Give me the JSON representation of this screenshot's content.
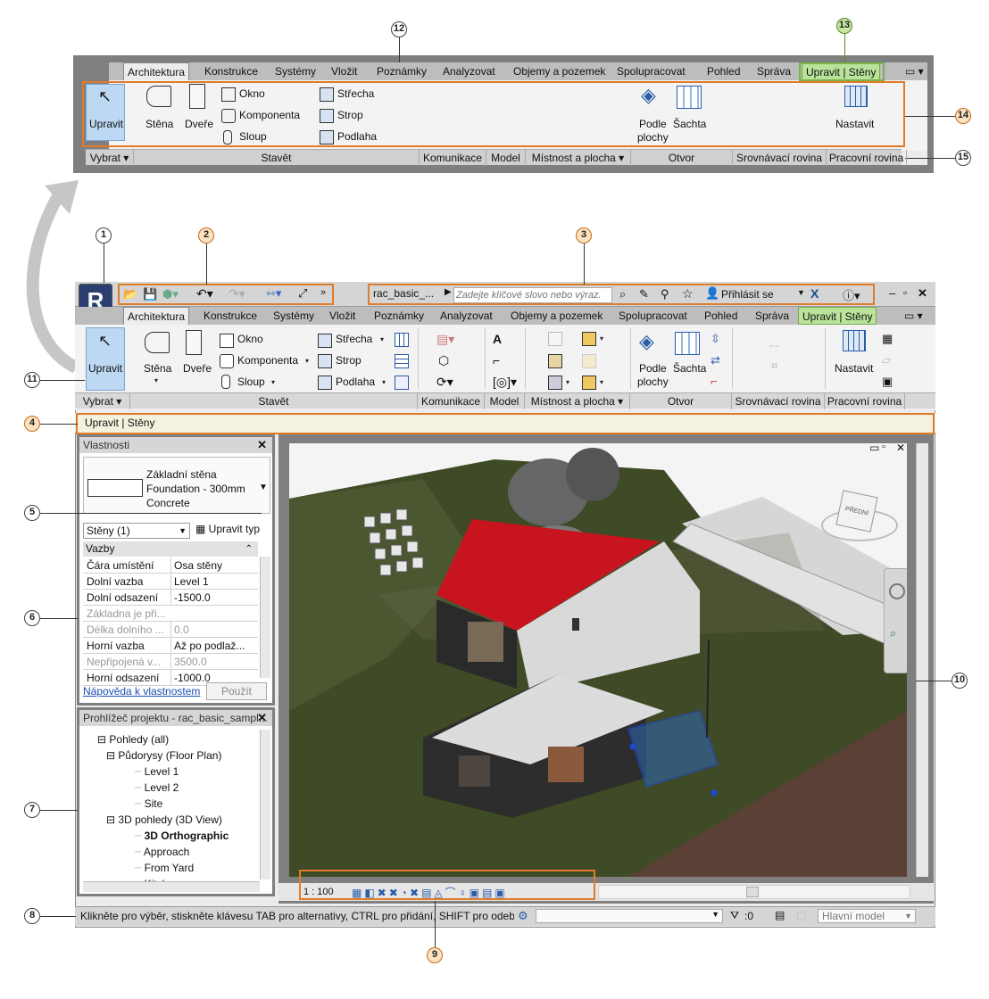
{
  "ribbon": {
    "tabs": [
      "Architektura",
      "Konstrukce",
      "Systémy",
      "Vložit",
      "Poznámky",
      "Analyzovat",
      "Objemy a pozemek",
      "Spolupracovat",
      "Pohled",
      "Správa"
    ],
    "context_tab": "Upravit | Stěny",
    "select_button": "Upravit",
    "wall": "Stěna",
    "door": "Dveře",
    "window": "Okno",
    "component": "Komponenta",
    "column": "Sloup",
    "roof": "Střecha",
    "ceiling": "Strop",
    "floor": "Podlaha",
    "opening_by_face": [
      "Podle",
      "plochy"
    ],
    "shaft": "Šachta",
    "set_workplane": "Nastavit",
    "panels": [
      "Vybrat",
      "Stavět",
      "Komunikace",
      "Model",
      "Místnost a plocha",
      "Otvor",
      "Srovnávací rovina",
      "Pracovní rovina"
    ]
  },
  "qat": {
    "file_name": "rac_basic_...",
    "search_placeholder": "Zadejte klíčové slovo nebo výraz.",
    "sign_in": "Přihlásit se"
  },
  "options_bar": "Upravit | Stěny",
  "properties": {
    "title": "Vlastnosti",
    "type_lines": [
      "Základní stěna",
      "Foundation - 300mm",
      "Concrete"
    ],
    "instance_filter": "Stěny (1)",
    "edit_type": "Upravit typ",
    "group": "Vazby",
    "rows": [
      {
        "k": "Čára umístění",
        "v": "Osa stěny",
        "dim": false
      },
      {
        "k": "Dolní vazba",
        "v": "Level 1",
        "dim": false
      },
      {
        "k": "Dolní odsazení",
        "v": "-1500.0",
        "dim": false
      },
      {
        "k": "Základna je při...",
        "v": "",
        "dim": true
      },
      {
        "k": "Délka dolního ...",
        "v": "0.0",
        "dim": true
      },
      {
        "k": "Horní vazba",
        "v": "Až po podlaž...",
        "dim": false
      },
      {
        "k": "Nepřipojená v...",
        "v": "3500.0",
        "dim": true
      },
      {
        "k": "Horní odsazení",
        "v": "-1000.0",
        "dim": false
      }
    ],
    "help_link": "Nápověda k vlastnostem",
    "apply": "Použít"
  },
  "browser": {
    "title": "Prohlížeč projektu - rac_basic_sampl...",
    "items": [
      {
        "label": "Pohledy (all)",
        "bold": false
      },
      {
        "label": "Půdorysy (Floor Plan)",
        "bold": false
      },
      {
        "label": "Level 1",
        "bold": false
      },
      {
        "label": "Level 2",
        "bold": false
      },
      {
        "label": "Site",
        "bold": false
      },
      {
        "label": "3D pohledy (3D View)",
        "bold": false
      },
      {
        "label": "3D Orthographic",
        "bold": true
      },
      {
        "label": "Approach",
        "bold": false
      },
      {
        "label": "From Yard",
        "bold": false
      },
      {
        "label": "Kitchen",
        "bold": false
      }
    ]
  },
  "view_control_bar": {
    "scale": "1 : 100"
  },
  "status": {
    "message": "Klikněte pro výběr, stiskněte klávesu TAB pro alternativy, CTRL pro přidání, SHIFT pro odebrá",
    "zero": ":0",
    "model": "Hlavní model"
  },
  "viewcube": {
    "front": "PŘEDNÍ",
    "right": "VPRAVO"
  },
  "callouts": [
    "1",
    "2",
    "3",
    "4",
    "5",
    "6",
    "7",
    "8",
    "9",
    "10",
    "11",
    "12",
    "13",
    "14",
    "15"
  ],
  "colors": {
    "highlight": "#e07b2a",
    "context": "#7ab34a",
    "roof": "#c8141e",
    "terrain": "#3f4a26"
  }
}
